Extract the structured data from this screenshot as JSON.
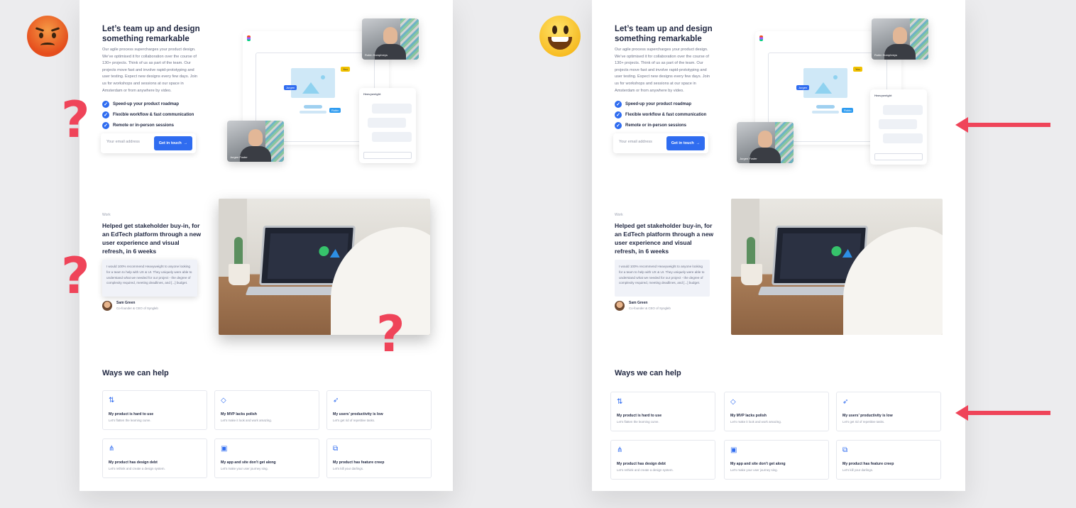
{
  "hero": {
    "title": "Let’s team up and design something remarkable",
    "body": "Our agile process supercharges your product design. We’ve optimised it for collaboration over the course of 130+ projects. Think of us as part of the team. Our projects move fast and involve rapid-prototyping and user testing. Expect new designs every few days. Join us for workshops and sessions at our space in Amsterdam or from anywhere by video.",
    "checks": [
      "Speed-up your product roadmap",
      "Flexible workflow & fast communication",
      "Remote or in-person sessions"
    ],
    "email_placeholder": "Your email address",
    "cta": "Get in touch"
  },
  "collab": {
    "video_top_name": "Robin Humphreys",
    "video_bottom_name": "Jurgen Foster",
    "chat_title": "Heavyweight",
    "tag_1": "Jurgen",
    "tag_2": "Robin",
    "tag_3": "You"
  },
  "work": {
    "label": "Work",
    "title": "Helped get stakeholder buy-in, for an EdTech platform through a new user experience and visual refresh, in 6 weeks",
    "quote": "I would 100% recommend Heavyweight to anyone looking for a team to help with UX & UI. They uniquely were able to understand what we needed for our project - the degree of complexity required, meeting deadlines, and [...] budget.",
    "author_name": "Sam Green",
    "author_role": "Co-founder & CEO of Syngleb"
  },
  "ways": {
    "title": "Ways we can help",
    "cards": [
      {
        "title": "My product is hard to use",
        "sub": "Let’s flatten the learning curve.",
        "icon": "arrows-icon",
        "glyph": "⇅"
      },
      {
        "title": "My MVP lacks polish",
        "sub": "Let’s make it look and work amazing.",
        "icon": "diamond-icon",
        "glyph": "◇"
      },
      {
        "title": "My users’ productivity is low",
        "sub": "Let’s get rid of repetitive tasks.",
        "icon": "rocket-icon",
        "glyph": "➶"
      },
      {
        "title": "My product has design debt",
        "sub": "Let’s rethink and create a design system.",
        "icon": "nodes-icon",
        "glyph": "⋔"
      },
      {
        "title": "My app and site don’t get along",
        "sub": "Let’s make your user journey sing.",
        "icon": "layout-icon",
        "glyph": "▣"
      },
      {
        "title": "My product has feature creep",
        "sub": "Let’s kill your darlings.",
        "icon": "shapes-icon",
        "glyph": "⧉"
      }
    ]
  },
  "colors": {
    "accent": "#2f6cf0",
    "alert": "#ef4459"
  }
}
